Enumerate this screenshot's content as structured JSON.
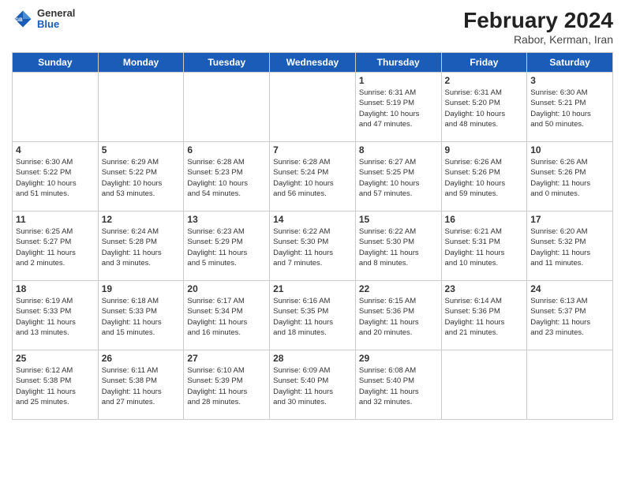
{
  "header": {
    "logo": {
      "general": "General",
      "blue": "Blue"
    },
    "title": "February 2024",
    "location": "Rabor, Kerman, Iran"
  },
  "days_of_week": [
    "Sunday",
    "Monday",
    "Tuesday",
    "Wednesday",
    "Thursday",
    "Friday",
    "Saturday"
  ],
  "weeks": [
    [
      {
        "day": "",
        "info": ""
      },
      {
        "day": "",
        "info": ""
      },
      {
        "day": "",
        "info": ""
      },
      {
        "day": "",
        "info": ""
      },
      {
        "day": "1",
        "info": "Sunrise: 6:31 AM\nSunset: 5:19 PM\nDaylight: 10 hours\nand 47 minutes."
      },
      {
        "day": "2",
        "info": "Sunrise: 6:31 AM\nSunset: 5:20 PM\nDaylight: 10 hours\nand 48 minutes."
      },
      {
        "day": "3",
        "info": "Sunrise: 6:30 AM\nSunset: 5:21 PM\nDaylight: 10 hours\nand 50 minutes."
      }
    ],
    [
      {
        "day": "4",
        "info": "Sunrise: 6:30 AM\nSunset: 5:22 PM\nDaylight: 10 hours\nand 51 minutes."
      },
      {
        "day": "5",
        "info": "Sunrise: 6:29 AM\nSunset: 5:22 PM\nDaylight: 10 hours\nand 53 minutes."
      },
      {
        "day": "6",
        "info": "Sunrise: 6:28 AM\nSunset: 5:23 PM\nDaylight: 10 hours\nand 54 minutes."
      },
      {
        "day": "7",
        "info": "Sunrise: 6:28 AM\nSunset: 5:24 PM\nDaylight: 10 hours\nand 56 minutes."
      },
      {
        "day": "8",
        "info": "Sunrise: 6:27 AM\nSunset: 5:25 PM\nDaylight: 10 hours\nand 57 minutes."
      },
      {
        "day": "9",
        "info": "Sunrise: 6:26 AM\nSunset: 5:26 PM\nDaylight: 10 hours\nand 59 minutes."
      },
      {
        "day": "10",
        "info": "Sunrise: 6:26 AM\nSunset: 5:26 PM\nDaylight: 11 hours\nand 0 minutes."
      }
    ],
    [
      {
        "day": "11",
        "info": "Sunrise: 6:25 AM\nSunset: 5:27 PM\nDaylight: 11 hours\nand 2 minutes."
      },
      {
        "day": "12",
        "info": "Sunrise: 6:24 AM\nSunset: 5:28 PM\nDaylight: 11 hours\nand 3 minutes."
      },
      {
        "day": "13",
        "info": "Sunrise: 6:23 AM\nSunset: 5:29 PM\nDaylight: 11 hours\nand 5 minutes."
      },
      {
        "day": "14",
        "info": "Sunrise: 6:22 AM\nSunset: 5:30 PM\nDaylight: 11 hours\nand 7 minutes."
      },
      {
        "day": "15",
        "info": "Sunrise: 6:22 AM\nSunset: 5:30 PM\nDaylight: 11 hours\nand 8 minutes."
      },
      {
        "day": "16",
        "info": "Sunrise: 6:21 AM\nSunset: 5:31 PM\nDaylight: 11 hours\nand 10 minutes."
      },
      {
        "day": "17",
        "info": "Sunrise: 6:20 AM\nSunset: 5:32 PM\nDaylight: 11 hours\nand 11 minutes."
      }
    ],
    [
      {
        "day": "18",
        "info": "Sunrise: 6:19 AM\nSunset: 5:33 PM\nDaylight: 11 hours\nand 13 minutes."
      },
      {
        "day": "19",
        "info": "Sunrise: 6:18 AM\nSunset: 5:33 PM\nDaylight: 11 hours\nand 15 minutes."
      },
      {
        "day": "20",
        "info": "Sunrise: 6:17 AM\nSunset: 5:34 PM\nDaylight: 11 hours\nand 16 minutes."
      },
      {
        "day": "21",
        "info": "Sunrise: 6:16 AM\nSunset: 5:35 PM\nDaylight: 11 hours\nand 18 minutes."
      },
      {
        "day": "22",
        "info": "Sunrise: 6:15 AM\nSunset: 5:36 PM\nDaylight: 11 hours\nand 20 minutes."
      },
      {
        "day": "23",
        "info": "Sunrise: 6:14 AM\nSunset: 5:36 PM\nDaylight: 11 hours\nand 21 minutes."
      },
      {
        "day": "24",
        "info": "Sunrise: 6:13 AM\nSunset: 5:37 PM\nDaylight: 11 hours\nand 23 minutes."
      }
    ],
    [
      {
        "day": "25",
        "info": "Sunrise: 6:12 AM\nSunset: 5:38 PM\nDaylight: 11 hours\nand 25 minutes."
      },
      {
        "day": "26",
        "info": "Sunrise: 6:11 AM\nSunset: 5:38 PM\nDaylight: 11 hours\nand 27 minutes."
      },
      {
        "day": "27",
        "info": "Sunrise: 6:10 AM\nSunset: 5:39 PM\nDaylight: 11 hours\nand 28 minutes."
      },
      {
        "day": "28",
        "info": "Sunrise: 6:09 AM\nSunset: 5:40 PM\nDaylight: 11 hours\nand 30 minutes."
      },
      {
        "day": "29",
        "info": "Sunrise: 6:08 AM\nSunset: 5:40 PM\nDaylight: 11 hours\nand 32 minutes."
      },
      {
        "day": "",
        "info": ""
      },
      {
        "day": "",
        "info": ""
      }
    ]
  ]
}
